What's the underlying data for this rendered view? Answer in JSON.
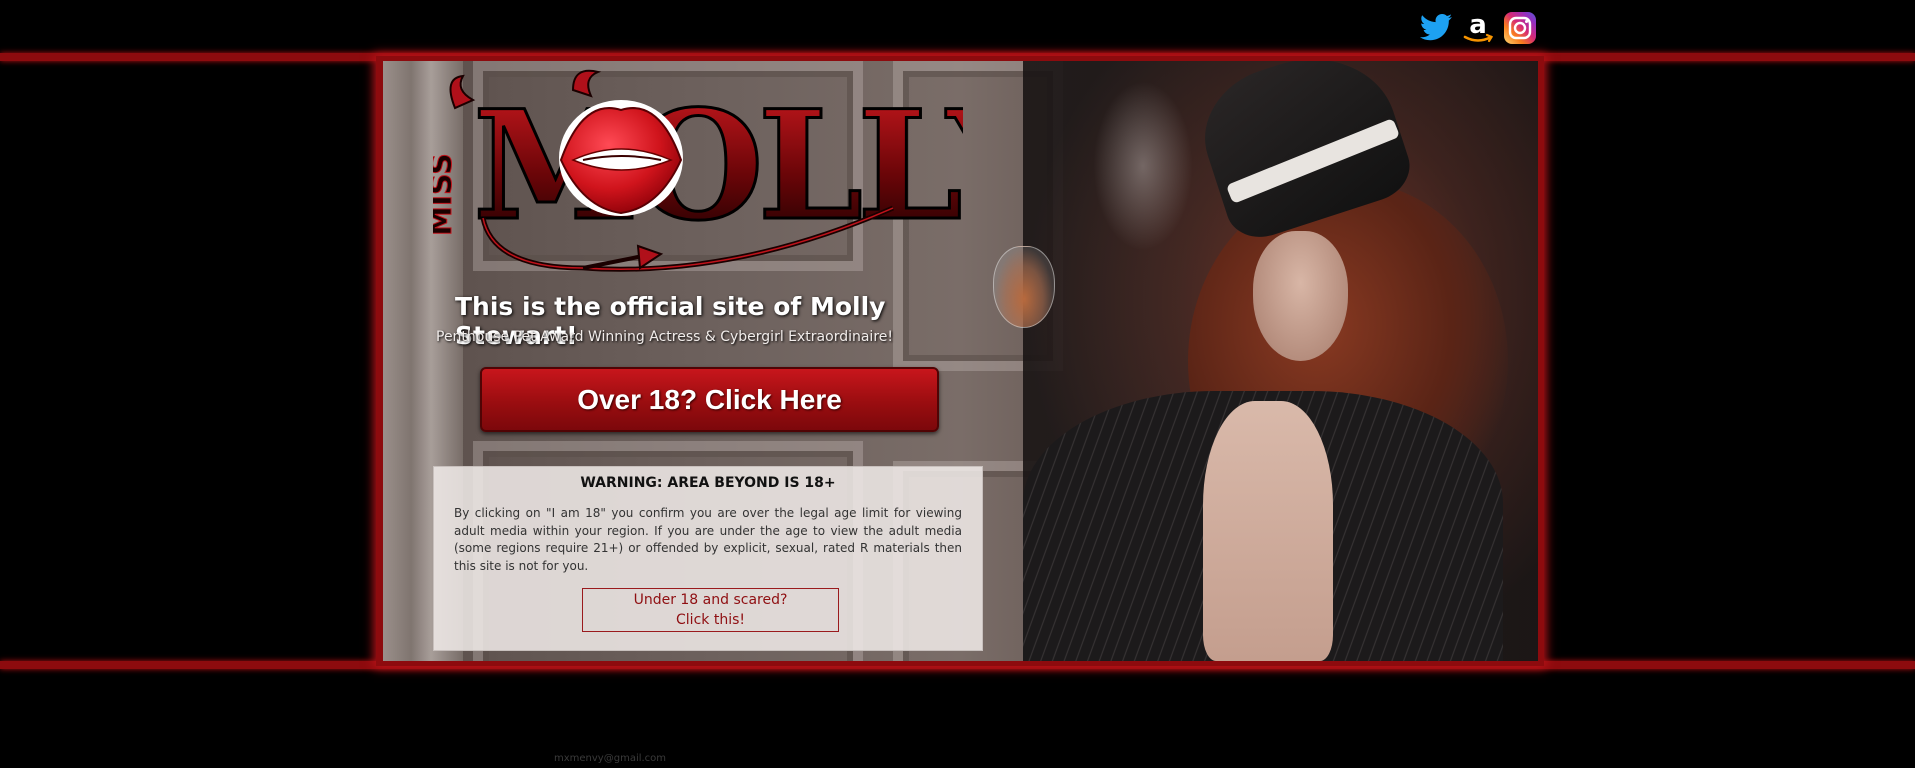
{
  "social": {
    "twitter": "twitter-icon",
    "amazon": "amazon-icon",
    "instagram": "instagram-icon"
  },
  "logo": {
    "prefix": "MISS",
    "name": "MOLLY"
  },
  "hero": {
    "headline": "This is the official site of Molly Stewart!",
    "subline": "Penthouse Pet Award Winning Actress & Cybergirl Extraordinaire!",
    "cta_label": "Over 18? Click Here"
  },
  "warning": {
    "title": "WARNING: AREA BEYOND IS 18+",
    "body": "By clicking on \"I am 18\" you confirm you are over the legal age limit for viewing adult media within your region. If you are under the age to view the adult media (some regions require 21+) or offended by explicit, sexual, rated R materials then this site is not for you.",
    "under18_line1": "Under 18 and scared?",
    "under18_line2": "Click this!"
  },
  "footer": {
    "email": "mxmenvy@gmail.com"
  },
  "colors": {
    "accent_red": "#8d0b0e",
    "cta_red": "#c8161c",
    "background": "#000000"
  }
}
